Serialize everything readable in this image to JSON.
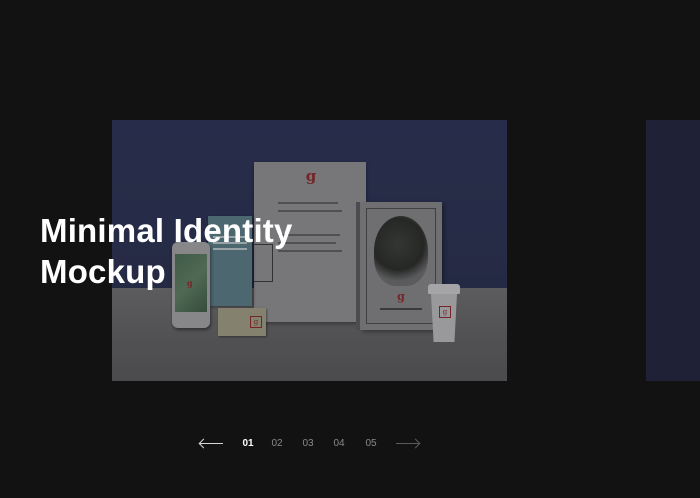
{
  "slide": {
    "title_line1": "Minimal Identity",
    "title_line2": "Mockup",
    "image_alt": "stationery identity mockup"
  },
  "pagination": {
    "prev_icon": "arrow-left-icon",
    "next_icon": "arrow-right-icon",
    "pages": [
      "01",
      "02",
      "03",
      "04",
      "05"
    ],
    "active_page": "01"
  },
  "colors": {
    "background": "#121213",
    "title": "#ffffff",
    "active_page": "#ffffff",
    "inactive_page": "#8a8a8c",
    "brand_accent": "#8c2a2a",
    "next_slide": "#1f2236"
  },
  "mockup_text": {
    "logo_letter": "g"
  }
}
